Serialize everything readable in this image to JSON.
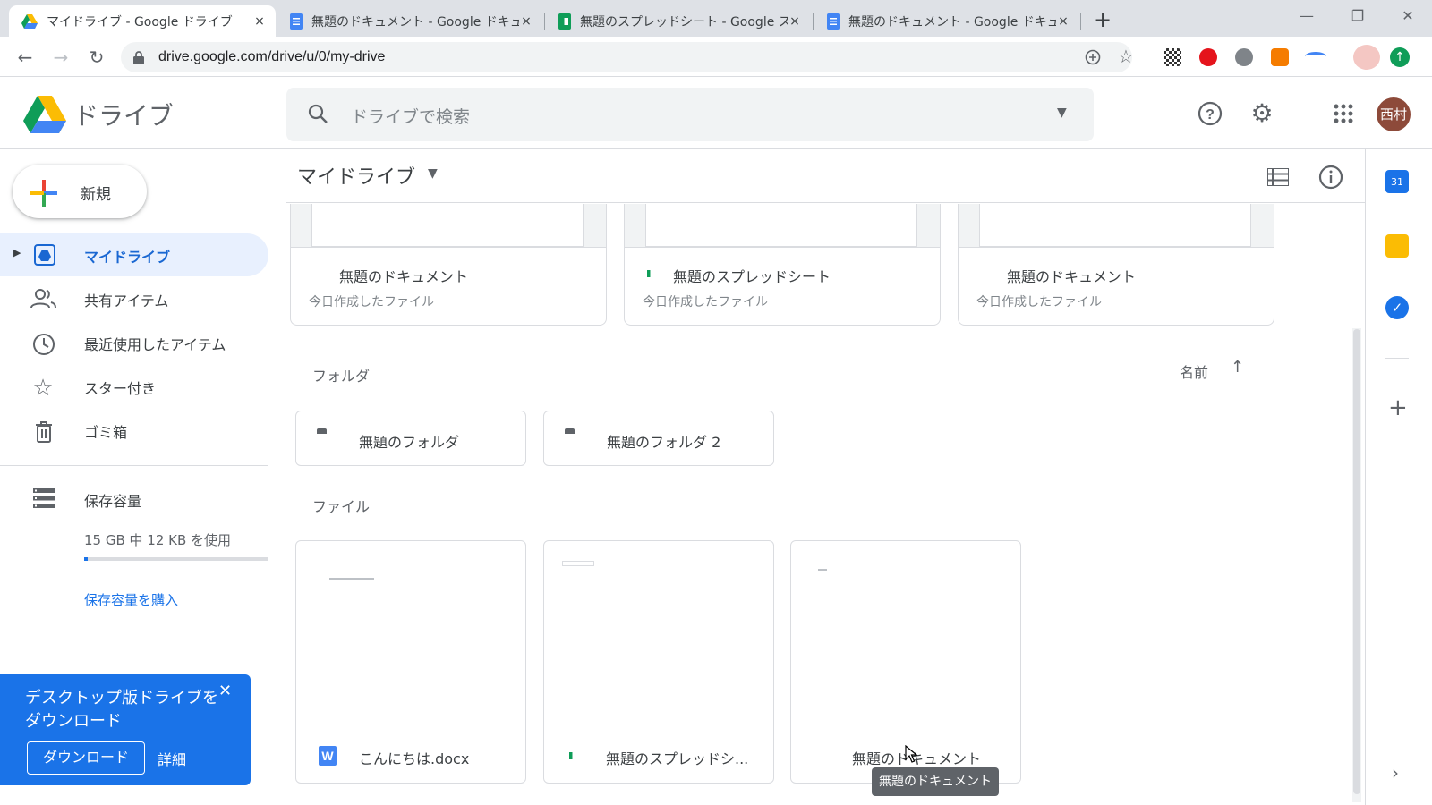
{
  "browser": {
    "tabs": [
      {
        "title": "マイドライブ - Google ドライブ",
        "icon": "drive-icon"
      },
      {
        "title": "無題のドキュメント - Google ドキュメ",
        "icon": "docs-icon"
      },
      {
        "title": "無題のスプレッドシート - Google スプ",
        "icon": "sheets-icon"
      },
      {
        "title": "無題のドキュメント - Google ドキュメ",
        "icon": "docs-icon"
      }
    ],
    "new_tab": "+",
    "close_glyph": "×",
    "url": "drive.google.com/drive/u/0/my-drive"
  },
  "header": {
    "brand": "ドライブ",
    "search_placeholder": "ドライブで検索",
    "avatar_text": "西村"
  },
  "sidebar": {
    "new_label": "新規",
    "items": [
      {
        "label": "マイドライブ",
        "icon": "my-drive-icon",
        "active": true
      },
      {
        "label": "共有アイテム",
        "icon": "shared-icon"
      },
      {
        "label": "最近使用したアイテム",
        "icon": "clock-icon"
      },
      {
        "label": "スター付き",
        "icon": "star-icon"
      },
      {
        "label": "ゴミ箱",
        "icon": "trash-icon"
      }
    ],
    "storage_label": "保存容量",
    "storage_usage": "15 GB 中 12 KB を使用",
    "storage_fraction": 0.02,
    "buy_storage": "保存容量を購入"
  },
  "promo": {
    "text": "デスクトップ版ドライブをダウンロード",
    "download": "ダウンロード",
    "details": "詳細"
  },
  "main": {
    "title": "マイドライブ",
    "quick_access": [
      {
        "name": "無題のドキュメント",
        "sub": "今日作成したファイル",
        "type": "doc"
      },
      {
        "name": "無題のスプレッドシート",
        "sub": "今日作成したファイル",
        "type": "sheet"
      },
      {
        "name": "無題のドキュメント",
        "sub": "今日作成したファイル",
        "type": "doc"
      }
    ],
    "folders_title": "フォルダ",
    "sort_label": "名前",
    "folders": [
      "無題のフォルダ",
      "無題のフォルダ 2"
    ],
    "files_title": "ファイル",
    "files": [
      {
        "name": "こんにちは.docx",
        "type": "word"
      },
      {
        "name": "無題のスプレッドシ...",
        "type": "sheet"
      },
      {
        "name": "無題のドキュメント",
        "type": "doc"
      }
    ],
    "tooltip": "無題のドキュメント"
  },
  "colors": {
    "accent": "#1a73e8",
    "active_bg": "#e8f0fe",
    "docs": "#4285f4",
    "sheets": "#0f9d58"
  }
}
